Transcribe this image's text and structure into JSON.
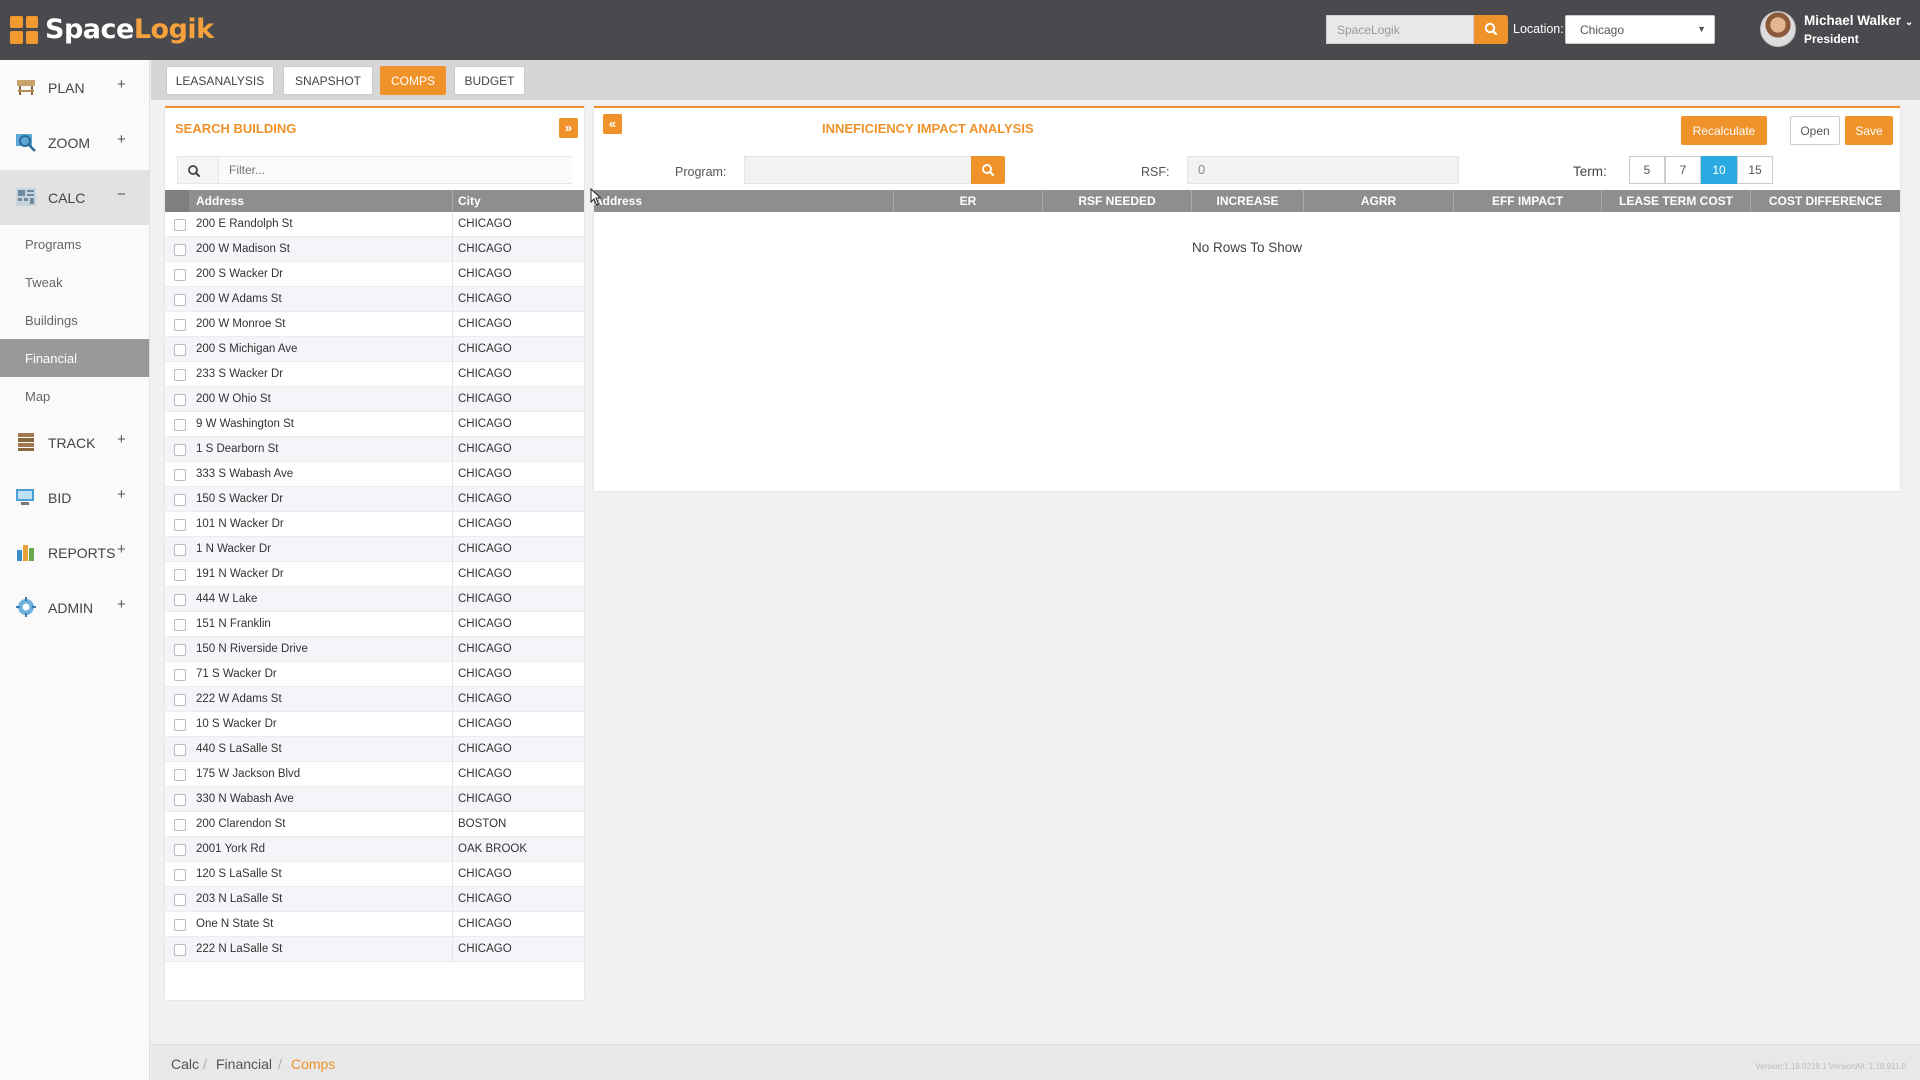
{
  "app": {
    "logo_main": "Space",
    "logo_accent": "Logik",
    "search_placeholder": "SpaceLogik",
    "location_label": "Location:",
    "location_value": "Chicago",
    "user_name": "Michael Walker",
    "user_role": "President"
  },
  "colors": {
    "accent": "#f0922a",
    "selected": "#29aae1",
    "header_bg": "#4a4a4e",
    "grid_header": "#8e8e8e"
  },
  "sidebar": {
    "items": [
      {
        "label": "PLAN",
        "icon": "plan-icon",
        "toggle": "+"
      },
      {
        "label": "ZOOM",
        "icon": "zoom-icon",
        "toggle": "+"
      },
      {
        "label": "CALC",
        "icon": "calc-icon",
        "toggle": "−"
      },
      {
        "label": "TRACK",
        "icon": "track-icon",
        "toggle": "+"
      },
      {
        "label": "BID",
        "icon": "bid-icon",
        "toggle": "+"
      },
      {
        "label": "REPORTS",
        "icon": "reports-icon",
        "toggle": "+"
      },
      {
        "label": "ADMIN",
        "icon": "admin-icon",
        "toggle": "+"
      }
    ],
    "calc_sub": [
      "Programs",
      "Tweak",
      "Buildings",
      "Financial",
      "Map"
    ]
  },
  "tabs": [
    "LEASANALYSIS",
    "SNAPSHOT",
    "COMPS",
    "BUDGET"
  ],
  "search_building": {
    "title": "SEARCH BUILDING",
    "collapse_glyph": "»",
    "filter_placeholder": "Filter...",
    "col_address": "Address",
    "col_city": "City",
    "rows": [
      [
        "200 E Randolph St",
        "CHICAGO"
      ],
      [
        "200 W Madison St",
        "CHICAGO"
      ],
      [
        "200 S Wacker Dr",
        "CHICAGO"
      ],
      [
        "200 W Adams St",
        "CHICAGO"
      ],
      [
        "200 W Monroe St",
        "CHICAGO"
      ],
      [
        "200 S Michigan Ave",
        "CHICAGO"
      ],
      [
        "233 S Wacker Dr",
        "CHICAGO"
      ],
      [
        "200 W Ohio St",
        "CHICAGO"
      ],
      [
        "9 W Washington St",
        "CHICAGO"
      ],
      [
        "1 S Dearborn St",
        "CHICAGO"
      ],
      [
        "333 S Wabash Ave",
        "CHICAGO"
      ],
      [
        "150 S Wacker Dr",
        "CHICAGO"
      ],
      [
        "101 N Wacker Dr",
        "CHICAGO"
      ],
      [
        "1 N Wacker Dr",
        "CHICAGO"
      ],
      [
        "191 N Wacker Dr",
        "CHICAGO"
      ],
      [
        "444 W Lake",
        "CHICAGO"
      ],
      [
        "151 N Franklin",
        "CHICAGO"
      ],
      [
        "150 N Riverside Drive",
        "CHICAGO"
      ],
      [
        "71 S Wacker Dr",
        "CHICAGO"
      ],
      [
        "222 W Adams St",
        "CHICAGO"
      ],
      [
        "10 S Wacker Dr",
        "CHICAGO"
      ],
      [
        "440 S LaSalle St",
        "CHICAGO"
      ],
      [
        "175 W Jackson Blvd",
        "CHICAGO"
      ],
      [
        "330 N Wabash Ave",
        "CHICAGO"
      ],
      [
        "200 Clarendon St",
        "BOSTON"
      ],
      [
        "2001 York Rd",
        "OAK BROOK"
      ],
      [
        "120 S LaSalle St",
        "CHICAGO"
      ],
      [
        "203 N LaSalle St",
        "CHICAGO"
      ],
      [
        "One N State St",
        "CHICAGO"
      ],
      [
        "222 N LaSalle St",
        "CHICAGO"
      ]
    ]
  },
  "impact": {
    "title": "INNEFICIENCY IMPACT ANALYSIS",
    "expand_glyph": "«",
    "recalculate": "Recalculate",
    "open": "Open",
    "save": "Save",
    "program_label": "Program:",
    "rsf_label": "RSF:",
    "rsf_value": "0",
    "term_label": "Term:",
    "terms": [
      "5",
      "7",
      "10",
      "15"
    ],
    "selected_term": "10",
    "columns": [
      "Address",
      "ER",
      "RSF NEEDED",
      "INCREASE",
      "AGRR",
      "EFF IMPACT",
      "LEASE TERM COST",
      "COST DIFFERENCE"
    ],
    "empty_text": "No Rows To Show"
  },
  "breadcrumb": [
    "Calc",
    "Financial",
    "Comps"
  ],
  "version": "Version:1.18.0218.1 VersionAll: 1.18.911.0"
}
